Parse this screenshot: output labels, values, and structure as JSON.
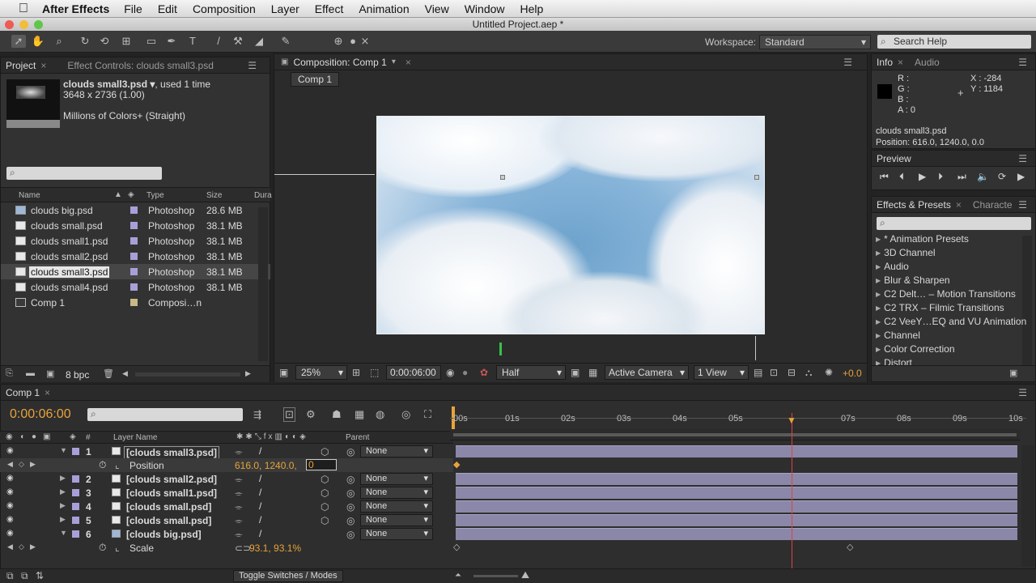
{
  "menubar": {
    "app": "After Effects",
    "items": [
      "File",
      "Edit",
      "Composition",
      "Layer",
      "Effect",
      "Animation",
      "View",
      "Window",
      "Help"
    ]
  },
  "window": {
    "title": "Untitled Project.aep *"
  },
  "workspace": {
    "label": "Workspace:",
    "value": "Standard",
    "search_placeholder": "Search Help"
  },
  "project": {
    "tab": "Project",
    "tab2": "Effect Controls: clouds small3.psd",
    "selected_name": "clouds small3.psd ▾",
    "used": ", used 1 time",
    "dims": "3648 x 2736 (1.00)",
    "colors": "Millions of Colors+ (Straight)",
    "columns": {
      "name": "Name",
      "type": "Type",
      "size": "Size",
      "dur": "Dura"
    },
    "items": [
      {
        "name": "clouds big.psd",
        "type": "Photoshop",
        "size": "28.6 MB"
      },
      {
        "name": "clouds small.psd",
        "type": "Photoshop",
        "size": "38.1 MB"
      },
      {
        "name": "clouds small1.psd",
        "type": "Photoshop",
        "size": "38.1 MB"
      },
      {
        "name": "clouds small2.psd",
        "type": "Photoshop",
        "size": "38.1 MB"
      },
      {
        "name": "clouds small3.psd",
        "type": "Photoshop",
        "size": "38.1 MB"
      },
      {
        "name": "clouds small4.psd",
        "type": "Photoshop",
        "size": "38.1 MB"
      },
      {
        "name": "Comp 1",
        "type": "Composi…n",
        "size": ""
      }
    ],
    "bpc": "8 bpc"
  },
  "composition": {
    "tab": "Composition: Comp 1",
    "subtab": "Comp 1",
    "zoom": "25%",
    "timecode": "0:00:06:00",
    "resolution": "Half",
    "camera": "Active Camera",
    "view": "1 View",
    "exposure": "+0.0"
  },
  "info": {
    "tab": "Info",
    "tab2": "Audio",
    "r": "R :",
    "g": "G :",
    "b": "B :",
    "a": "A : 0",
    "x": "X : -284",
    "y": "Y : 1184",
    "layer": "clouds small3.psd",
    "position": "Position: 616.0, 1240.0, 0.0"
  },
  "preview": {
    "tab": "Preview"
  },
  "effects": {
    "tab": "Effects & Presets",
    "tab2": "Characte",
    "items": [
      "* Animation Presets",
      "3D Channel",
      "Audio",
      "Blur & Sharpen",
      "C2 Delt… – Motion Transitions",
      "C2 TRX – Filmic Transitions",
      "C2 VeeY…EQ and VU Animation",
      "Channel",
      "Color Correction",
      "Distort"
    ]
  },
  "timeline": {
    "tab": "Comp 1",
    "timecode": "0:00:06:00",
    "col_layer_name": "Layer Name",
    "col_parent": "Parent",
    "col_num": "#",
    "ruler": [
      "00s",
      "01s",
      "02s",
      "03s",
      "04s",
      "05s",
      "07s",
      "08s",
      "09s",
      "10s"
    ],
    "layers": [
      {
        "num": "1",
        "name": "[clouds small3.psd]",
        "parent": "None"
      },
      {
        "num": "2",
        "name": "[clouds small2.psd]",
        "parent": "None"
      },
      {
        "num": "3",
        "name": "[clouds small1.psd]",
        "parent": "None"
      },
      {
        "num": "4",
        "name": "[clouds small.psd]",
        "parent": "None"
      },
      {
        "num": "5",
        "name": "[clouds small.psd]",
        "parent": "None"
      },
      {
        "num": "6",
        "name": "[clouds big.psd]",
        "parent": "None"
      }
    ],
    "position_label": "Position",
    "position_value": "616.0, 1240.0,",
    "position_edit": "0",
    "scale_label": "Scale",
    "scale_value": "93.1, 93.1%",
    "toggle": "Toggle Switches / Modes"
  },
  "colors": {
    "accent": "#e8a33a",
    "playhead": "#e04040",
    "layer_bar": "#8b87a8",
    "label": "#a7a0d8"
  }
}
